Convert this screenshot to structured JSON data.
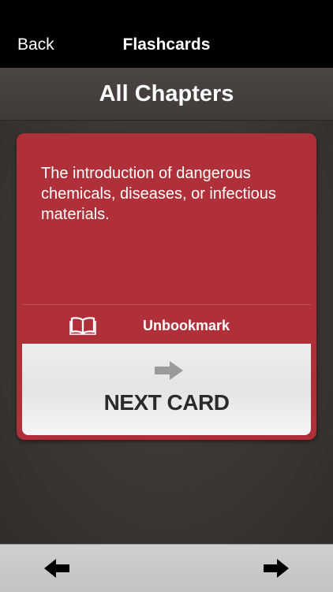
{
  "nav": {
    "back_label": "Back",
    "title": "Flashcards"
  },
  "section": {
    "title": "All Chapters"
  },
  "card": {
    "text": "The introduction of dangerous chemicals, diseases, or infectious materials.",
    "bookmark_label": "Unbookmark",
    "bookmark_icon": "book-icon",
    "next_label": "NEXT CARD",
    "next_icon": "arrow-right-icon"
  },
  "toolbar": {
    "prev_icon": "arrow-left-icon",
    "next_icon": "arrow-right-icon"
  },
  "colors": {
    "card_red": "#b0303a",
    "nav_black": "#000000",
    "background_dark": "#3a3633",
    "toolbar_gray": "#c8c8cb"
  }
}
